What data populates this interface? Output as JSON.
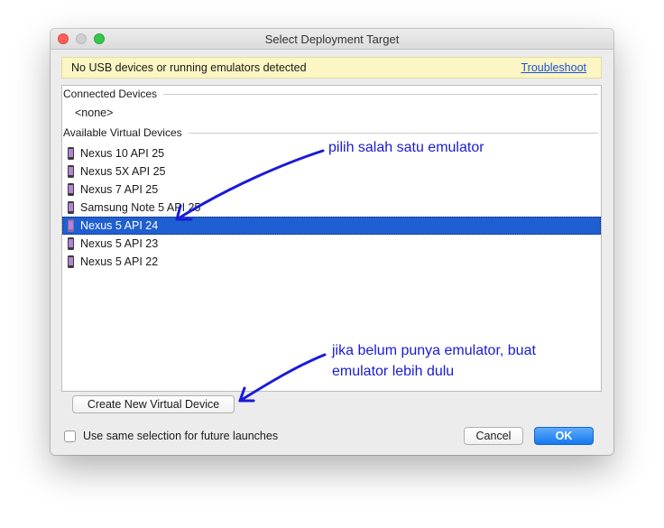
{
  "window": {
    "title": "Select Deployment Target"
  },
  "banner": {
    "message": "No USB devices or running emulators detected",
    "link": "Troubleshoot"
  },
  "connected": {
    "header": "Connected Devices",
    "none_label": "<none>"
  },
  "available": {
    "header": "Available Virtual Devices",
    "devices": [
      {
        "label": "Nexus 10 API 25",
        "icon": "phone-icon"
      },
      {
        "label": "Nexus 5X API 25",
        "icon": "phone-icon"
      },
      {
        "label": "Nexus 7 API 25",
        "icon": "phone-icon"
      },
      {
        "label": "Samsung Note 5 API 25",
        "icon": "phone-icon"
      },
      {
        "label": "Nexus 5 API 24",
        "icon": "phone-icon",
        "selected": true
      },
      {
        "label": "Nexus 5 API 23",
        "icon": "phone-icon"
      },
      {
        "label": "Nexus 5 API 22",
        "icon": "phone-icon"
      }
    ]
  },
  "buttons": {
    "create": "Create New Virtual Device",
    "cancel": "Cancel",
    "ok": "OK"
  },
  "checkbox": {
    "label": "Use same selection for future launches",
    "checked": false
  },
  "annotations": {
    "choose": "pilih salah satu emulator",
    "create_line1": "jika belum punya emulator, buat",
    "create_line2": "emulator lebih dulu"
  },
  "colors": {
    "selection": "#1f5fd1",
    "ok_button": "#1478f0",
    "annotation": "#1a1ad8",
    "banner_bg": "#fbf6c3"
  }
}
